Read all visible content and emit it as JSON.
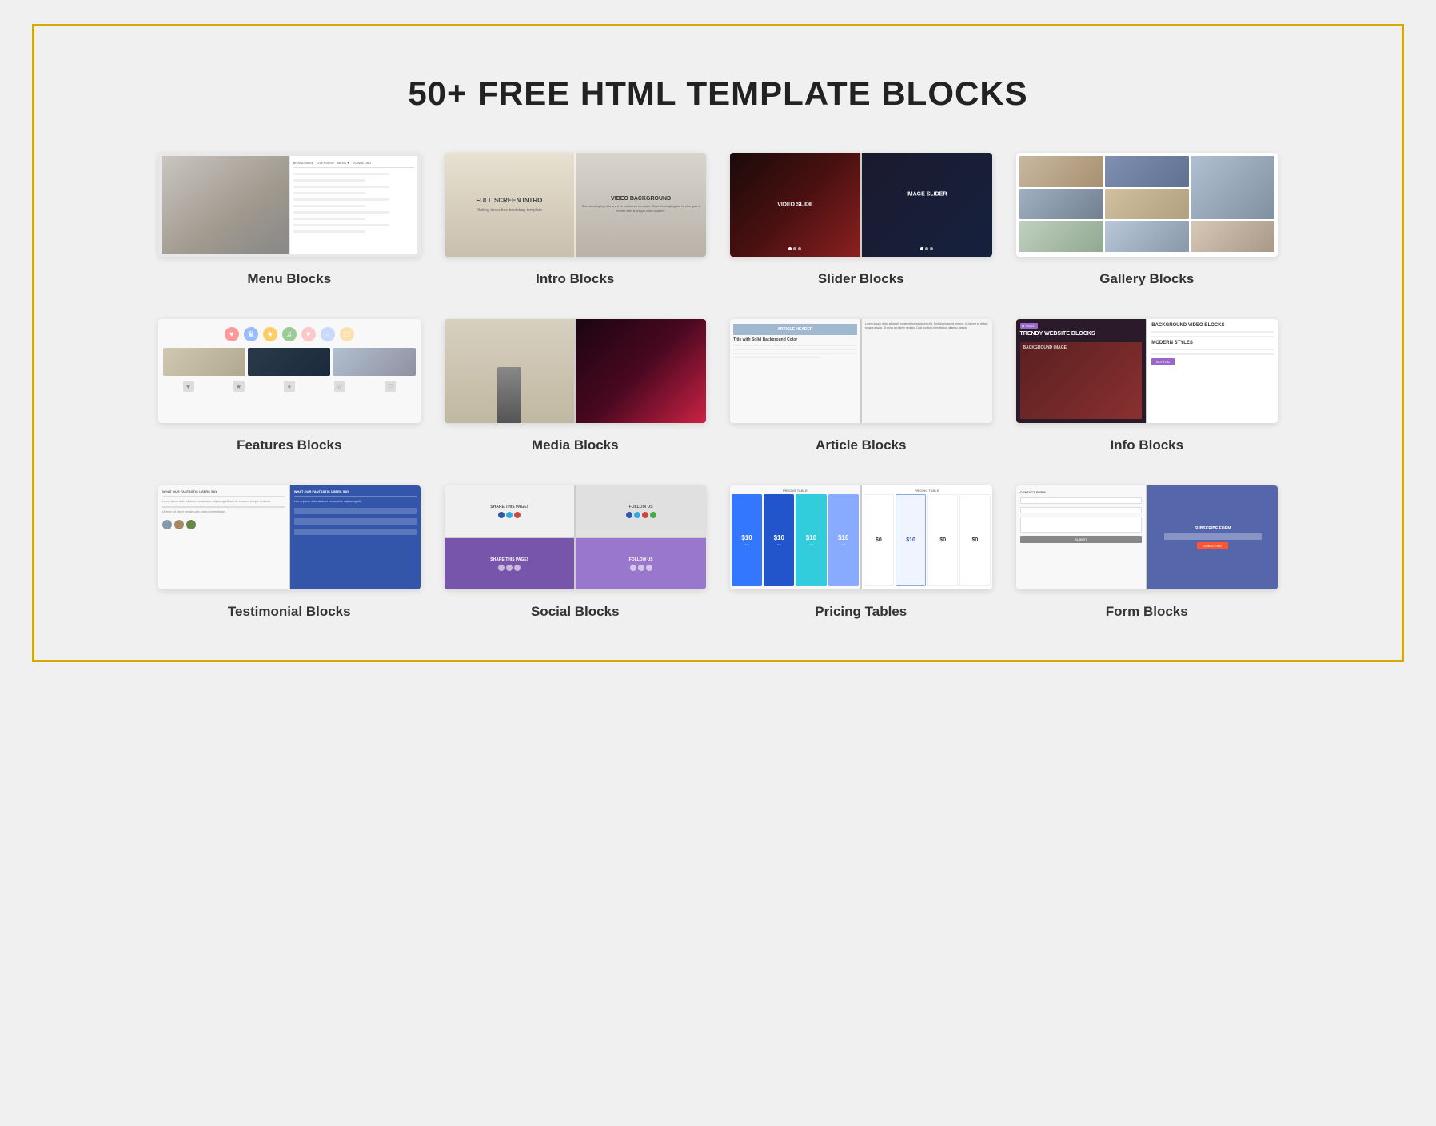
{
  "page": {
    "title": "50+ FREE HTML TEMPLATE BLOCKS",
    "border_color": "#d4aa00"
  },
  "blocks": [
    {
      "id": "menu",
      "label": "Menu Blocks",
      "type": "menu"
    },
    {
      "id": "intro",
      "label": "Intro Blocks",
      "type": "intro",
      "intro_left_title": "FULL SCREEN INTRO",
      "intro_right_title": "VIDEO BACKGROUND"
    },
    {
      "id": "slider",
      "label": "Slider Blocks",
      "type": "slider",
      "left_text": "VIDEO SLIDE",
      "right_text": "IMAGE SLIDER"
    },
    {
      "id": "gallery",
      "label": "Gallery Blocks",
      "type": "gallery"
    },
    {
      "id": "features",
      "label": "Features Blocks",
      "type": "features"
    },
    {
      "id": "media",
      "label": "Media Blocks",
      "type": "media"
    },
    {
      "id": "article",
      "label": "Article Blocks",
      "type": "article",
      "header_text": "ARTICLE HEADER",
      "subtitle": "Title with Solid Background Color"
    },
    {
      "id": "info",
      "label": "Info Blocks",
      "type": "info",
      "left_title1": "TRENDY WEBSITE BLOCKS",
      "left_title2": "BACKGROUND IMAGE",
      "right_title1": "BACKGROUND VIDEO BLOCKS",
      "right_title2": "MODERN STYLES"
    },
    {
      "id": "testimonial",
      "label": "Testimonial Blocks",
      "type": "testimonial",
      "heading": "WHAT OUR FANTASTIC USERS SAY"
    },
    {
      "id": "social",
      "label": "Social Blocks",
      "type": "social",
      "share_text": "SHARE THIS PAGE!",
      "follow_text": "FOLLOW US",
      "share_text2": "SHARE THIS PAGE!",
      "follow_text2": "FOLLOW US"
    },
    {
      "id": "pricing",
      "label": "Pricing Tables",
      "type": "pricing",
      "label_text": "PRICING TABLE"
    },
    {
      "id": "form",
      "label": "Form Blocks",
      "type": "form",
      "contact_text": "CONTACT FORM",
      "subscribe_text": "SUBSCRIBE FORM"
    }
  ]
}
